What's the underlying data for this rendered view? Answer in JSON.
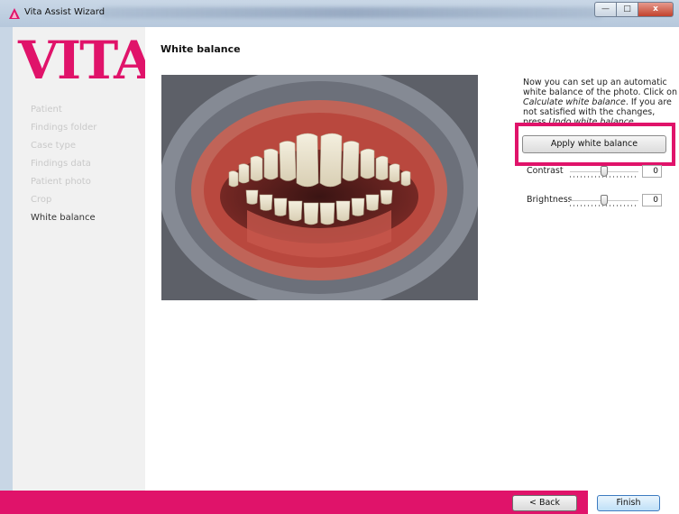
{
  "window": {
    "title": "Vita Assist Wizard",
    "minimize_label": "—",
    "maximize_label": "□",
    "close_label": "x",
    "app_icon": "vita-triangle-icon"
  },
  "sidebar": {
    "logo": "VITA",
    "items": [
      {
        "label": "Patient",
        "active": false
      },
      {
        "label": "Findings folder",
        "active": false
      },
      {
        "label": "Case type",
        "active": false
      },
      {
        "label": "Findings data",
        "active": false
      },
      {
        "label": "Patient photo",
        "active": false
      },
      {
        "label": "Crop",
        "active": false
      },
      {
        "label": "White balance",
        "active": true
      }
    ]
  },
  "main": {
    "heading": "White balance",
    "photo": "dental-photo-teeth",
    "description": {
      "part1": "Now you can set up an automatic white balance of the photo. Click on ",
      "italic1": "Calculate white balance",
      "part2": ". If you are not satisfied with the changes, press ",
      "italic2": "Undo white balance",
      "part3": "."
    },
    "apply_button": "Apply white balance",
    "contrast": {
      "label": "Contrast",
      "value": "0"
    },
    "brightness": {
      "label": "Brightness",
      "value": "0"
    }
  },
  "footer": {
    "back": "< Back",
    "finish": "Finish"
  },
  "colors": {
    "brand": "#e0136a"
  }
}
